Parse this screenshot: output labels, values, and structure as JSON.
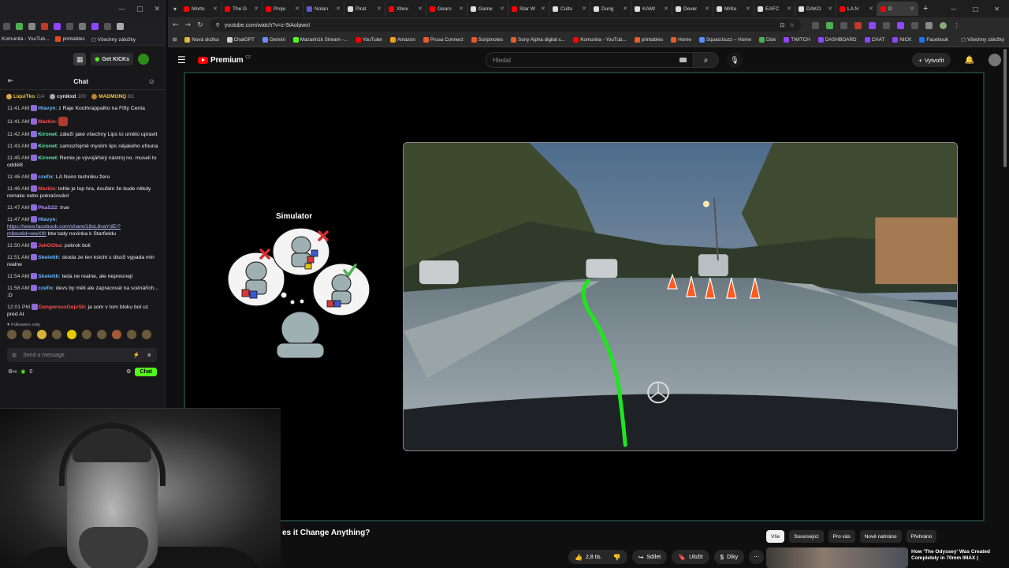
{
  "left": {
    "window_controls": [
      "—",
      "□",
      "✕"
    ],
    "bookmarks": [
      "Komunita - YouTub...",
      "printables",
      "Všechny záložky"
    ],
    "get_kicks": "Get KICKs",
    "chat_title": "Chat",
    "top_gifters": [
      {
        "name": "LiquiTko",
        "count": "114"
      },
      {
        "name": "cynikxd",
        "count": "100"
      },
      {
        "name": "MADMONQ",
        "count": "8C"
      }
    ],
    "messages": [
      {
        "time": "11:41 AM",
        "user": "Hlavyn",
        "color": "#69b6ff",
        "text": "z Raje Koothrappalho na Fifty Centa"
      },
      {
        "time": "11:41 AM",
        "user": "Markio",
        "color": "#ff4b4b",
        "text": ""
      },
      {
        "time": "11:42 AM",
        "user": "Kironet",
        "color": "#5ee6a6",
        "text": "záleží jaké všechny Lips to umělo upravit"
      },
      {
        "time": "11:43 AM",
        "user": "Kironet",
        "color": "#5ee6a6",
        "text": "samozřejmě myslím lips nějakého ufouna"
      },
      {
        "time": "11:45 AM",
        "user": "Kironet",
        "color": "#5ee6a6",
        "text": "Remix je vývojářský nástroj no. museli to oddělit"
      },
      {
        "time": "11:46 AM",
        "user": "czefix",
        "color": "#69b6ff",
        "text": "LA Noire techniku žeru"
      },
      {
        "time": "11:46 AM",
        "user": "Markio",
        "color": "#ff4b4b",
        "text": "tohle je top hra, doufám že bude někdy remake nebo pokračování"
      },
      {
        "time": "11:47 AM",
        "user": "PkaS22",
        "color": "#b98cff",
        "text": "true"
      },
      {
        "time": "11:47 AM",
        "user": "Hlavyn",
        "color": "#69b6ff",
        "text": "",
        "link": "https://www.facebook.com/share/18sL8vaYdE/?mibextid=wwXIfr",
        "after": " btw tady novinka k Starfieldu"
      },
      {
        "time": "11:50 AM",
        "user": "JakOOba",
        "color": "#ff4b4b",
        "text": "pokrok boli"
      },
      {
        "time": "11:51 AM",
        "user": "Skeletth",
        "color": "#69b6ff",
        "text": "skoda ze ten ksicht s diss5 vypada min realne"
      },
      {
        "time": "11:54 AM",
        "user": "Skeletth",
        "color": "#69b6ff",
        "text": "teda ne realne, ale nepresnejí"
      },
      {
        "time": "11:58 AM",
        "user": "czefix",
        "color": "#69b6ff",
        "text": "devs by měli ale zapracovat na scénářích... :D"
      },
      {
        "time": "12:01 PM",
        "user": "DangerousGejvSk",
        "color": "#ff4b4b",
        "text": "ja som v tom bloku bol uz pred AI"
      }
    ],
    "followers_only": "Followers only",
    "input_placeholder": "Send a message",
    "viewer_count": "0",
    "chat_button": "Chat"
  },
  "browser": {
    "tabs": [
      {
        "label": "Morto",
        "color": "#ff0000"
      },
      {
        "label": "The G",
        "color": "#ff0000"
      },
      {
        "label": "Proje",
        "color": "#ff0000"
      },
      {
        "label": "Nolan",
        "color": "#5b5bd6"
      },
      {
        "label": "Pirat",
        "color": "#dddddd"
      },
      {
        "label": "Xbox",
        "color": "#ff0000"
      },
      {
        "label": "Gears",
        "color": "#ff0000"
      },
      {
        "label": "Game",
        "color": "#dddddd"
      },
      {
        "label": "Star W",
        "color": "#ff0000"
      },
      {
        "label": "Cultu",
        "color": "#dddddd"
      },
      {
        "label": "Dung",
        "color": "#dddddd"
      },
      {
        "label": "KAMI",
        "color": "#dddddd"
      },
      {
        "label": "Dever",
        "color": "#dddddd"
      },
      {
        "label": "MrKe",
        "color": "#dddddd"
      },
      {
        "label": "EAFC",
        "color": "#dddddd"
      },
      {
        "label": "DAKO",
        "color": "#dddddd"
      },
      {
        "label": "LA N",
        "color": "#ff0000"
      },
      {
        "label": "D",
        "color": "#ff0000"
      }
    ],
    "window_controls": [
      "—",
      "□",
      "✕"
    ],
    "url": "youtube.com/watch?v=z-5tAolpwoI",
    "bookmarks": [
      {
        "label": "Nová složka",
        "color": "#e6b43c"
      },
      {
        "label": "ChatGPT",
        "color": "#cccccc"
      },
      {
        "label": "Gemini",
        "color": "#6a8cff"
      },
      {
        "label": "Mazarin1k Stream -...",
        "color": "#53fc18"
      },
      {
        "label": "YouTube",
        "color": "#ff0000"
      },
      {
        "label": "Amazon",
        "color": "#f0a020"
      },
      {
        "label": "Prusa Connect",
        "color": "#e65c2a"
      },
      {
        "label": "Scriptnotes",
        "color": "#e65c2a"
      },
      {
        "label": "Sony Alpha digital c...",
        "color": "#e65c2a"
      },
      {
        "label": "Komunita - YouTub...",
        "color": "#ff0000"
      },
      {
        "label": "printables",
        "color": "#e65c2a"
      },
      {
        "label": "Home",
        "color": "#e65c2a"
      },
      {
        "label": "Squad.buzz – Home",
        "color": "#5b8cff"
      },
      {
        "label": "Disk",
        "color": "#4caf50"
      },
      {
        "label": "TWITCH",
        "color": "#9146ff"
      },
      {
        "label": "DASHBOARD",
        "color": "#9146ff"
      },
      {
        "label": "CHAT",
        "color": "#9146ff"
      },
      {
        "label": "NICK",
        "color": "#9146ff"
      },
      {
        "label": "Facebook",
        "color": "#1877f2"
      }
    ],
    "all_bookmarks": "Všechny záložky"
  },
  "youtube": {
    "premium_label": "Premium",
    "country": "CZ",
    "search_placeholder": "Hledat",
    "create_label": "Vytvořit",
    "slide_title": "Simulator",
    "video_title": "es it Change Anything?",
    "actions": {
      "likes": "2,8 tis.",
      "share": "Sdílet",
      "save": "Uložit",
      "thanks": "Díky"
    },
    "chips": [
      "Vše",
      "Související",
      "Pro vás",
      "Nově nahráno",
      "Přehráno"
    ],
    "recommendation_title": "How 'The Odyssey' Was Created Completely in 70mm IMAX |"
  },
  "colors": {
    "kick_green": "#53fc18",
    "youtube_red": "#ff0000",
    "trajectory_green": "#1ee61e",
    "cone_orange": "#ff5a1f"
  }
}
